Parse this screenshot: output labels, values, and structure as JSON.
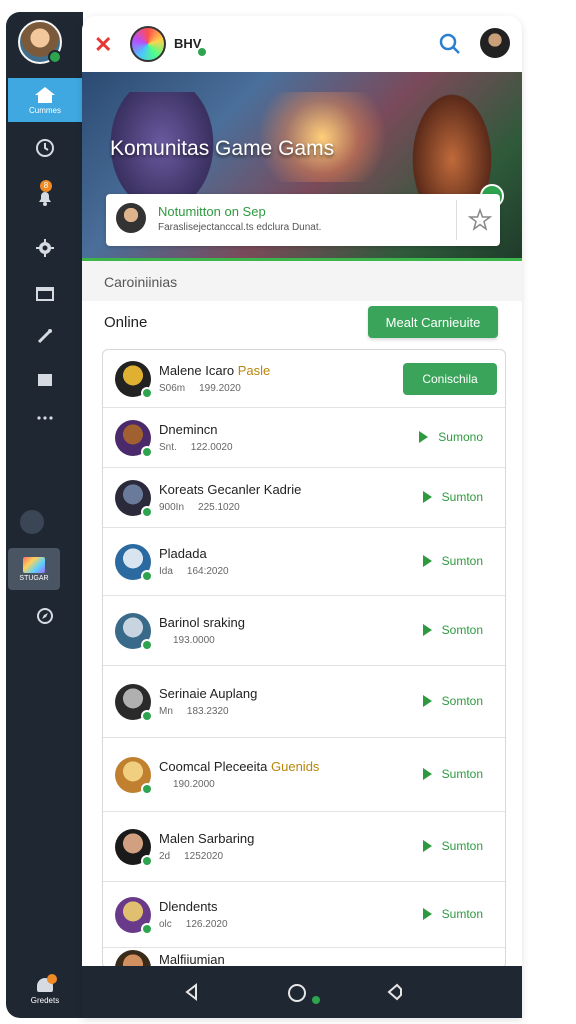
{
  "rail": {
    "home_label": "Cummes",
    "store_label": "STUGAR",
    "bottom_label": "Gredets",
    "badge": "8"
  },
  "topbar": {
    "brand_label": "BHV",
    "search_icon": "search-icon",
    "close_icon": "close-icon"
  },
  "hero": {
    "title": "Komunitas Game Gams"
  },
  "notification": {
    "title": "Notumitton on Sep",
    "subtitle": "Faraslisejectanccal.ts edclura Dunat."
  },
  "section": {
    "title": "Caroiniinias",
    "online_label": "Online",
    "main_button": "Mealt Carnieuite"
  },
  "players": [
    {
      "name": "Malene Icaro ",
      "name_highlight": "Pasle",
      "meta_a": "S06m",
      "meta_b": "199.2020",
      "action": "Conischila",
      "style": "button",
      "avatar": [
        "#e0b030",
        "#222"
      ]
    },
    {
      "name": "Dnemincn",
      "name_highlight": "",
      "meta_a": "Snt.",
      "meta_b": "122.0020",
      "action": "Sumono",
      "style": "play",
      "avatar": [
        "#a06030",
        "#4a2a6a"
      ]
    },
    {
      "name": "Koreats Gecanler Kadrie",
      "name_highlight": "",
      "meta_a": "900In",
      "meta_b": "225.1020",
      "action": "Sumton",
      "style": "play",
      "avatar": [
        "#6a7a9a",
        "#2a2a3a"
      ]
    },
    {
      "name": "Pladada",
      "name_highlight": "",
      "meta_a": "Ida",
      "meta_b": "164:2020",
      "action": "Sumton",
      "style": "play",
      "avatar": [
        "#d8e4f0",
        "#2a6aa0"
      ]
    },
    {
      "name": "Barinol sraking",
      "name_highlight": "",
      "meta_a": "",
      "meta_b": "193.0000",
      "action": "Somton",
      "style": "play",
      "avatar": [
        "#c8d4e0",
        "#3a6a8a"
      ]
    },
    {
      "name": "Serinaie Auplang",
      "name_highlight": "",
      "meta_a": "Mn",
      "meta_b": "183.2320",
      "action": "Somton",
      "style": "play",
      "avatar": [
        "#b0b0b0",
        "#2a2a2a"
      ]
    },
    {
      "name": "Coomcal Pleceeita ",
      "name_highlight": "Guenids",
      "meta_a": "",
      "meta_b": "190.2000",
      "action": "Sumton",
      "style": "play",
      "avatar": [
        "#f0d080",
        "#c08030"
      ]
    },
    {
      "name": "Malen Sarbaring",
      "name_highlight": "",
      "meta_a": "2d",
      "meta_b": "1252020",
      "action": "Sumton",
      "style": "play",
      "avatar": [
        "#d0a080",
        "#1a1a1a"
      ]
    },
    {
      "name": "Dlendents",
      "name_highlight": "",
      "meta_a": "olc",
      "meta_b": "126.2020",
      "action": "Sumton",
      "style": "play",
      "avatar": [
        "#e0c070",
        "#6a3a8a"
      ]
    },
    {
      "name": "Malfiiumian",
      "name_highlight": "",
      "meta_a": "",
      "meta_b": "",
      "action": "",
      "style": "none",
      "avatar": [
        "#d09060",
        "#3a2a1a"
      ]
    }
  ],
  "colors": {
    "accent_green": "#3aa55a",
    "rail_bg": "#1f2732",
    "home_active": "#3fa8e0",
    "close_red": "#e53935"
  }
}
